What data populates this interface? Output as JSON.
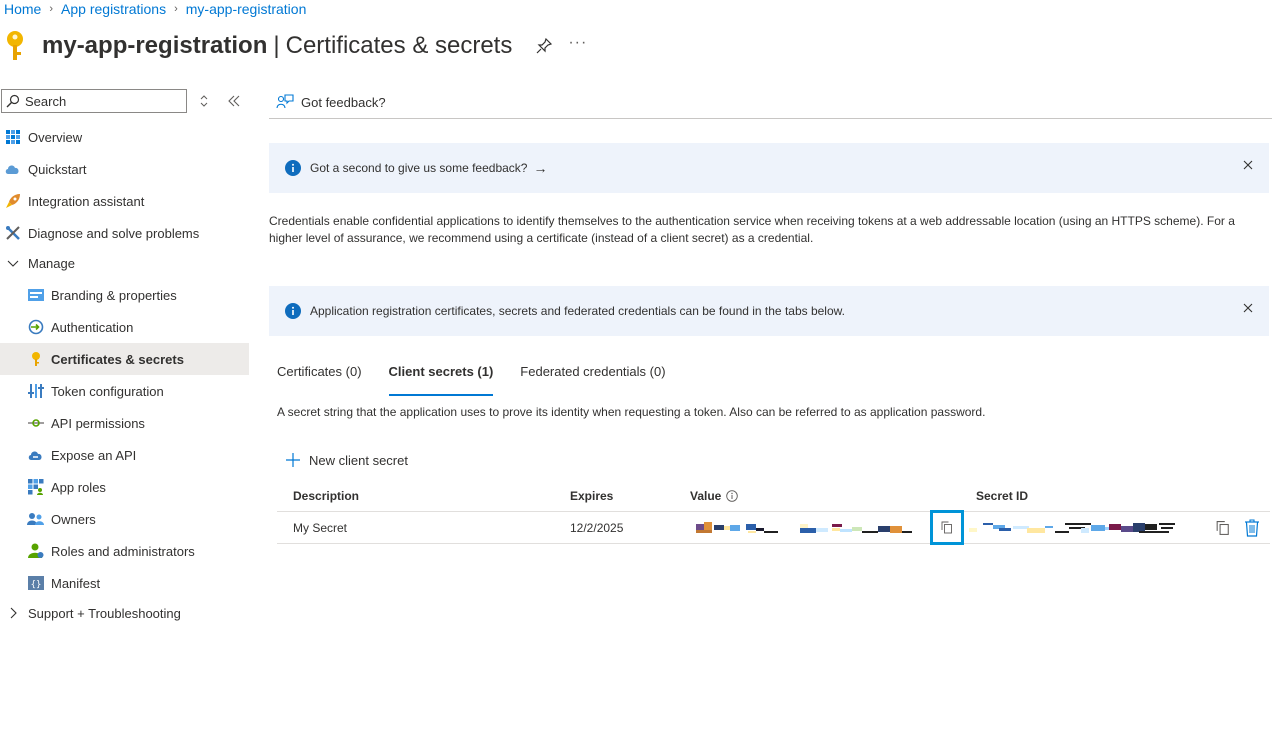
{
  "breadcrumb": {
    "home": "Home",
    "app_registrations": "App registrations",
    "current": "my-app-registration"
  },
  "title": {
    "app_name": "my-app-registration",
    "separator": "|",
    "page": "Certificates & secrets",
    "more": "···"
  },
  "sidebar": {
    "search_placeholder": "Search",
    "items": {
      "overview": "Overview",
      "quickstart": "Quickstart",
      "integration_assistant": "Integration assistant",
      "diagnose": "Diagnose and solve problems",
      "manage": "Manage",
      "branding": "Branding & properties",
      "authentication": "Authentication",
      "certificates": "Certificates & secrets",
      "token_configuration": "Token configuration",
      "api_permissions": "API permissions",
      "expose_api": "Expose an API",
      "app_roles": "App roles",
      "owners": "Owners",
      "roles_admins": "Roles and administrators",
      "manifest": "Manifest",
      "support": "Support + Troubleshooting"
    }
  },
  "toolbar": {
    "feedback": "Got feedback?"
  },
  "banners": {
    "feedback_prompt": "Got a second to give us some feedback?",
    "feedback_arrow": "→",
    "tabs_info": "Application registration certificates, secrets and federated credentials can be found in the tabs below."
  },
  "description": "Credentials enable confidential applications to identify themselves to the authentication service when receiving tokens at a web addressable location (using an HTTPS scheme). For a higher level of assurance, we recommend using a certificate (instead of a client secret) as a credential.",
  "tabs": {
    "certificates": "Certificates (0)",
    "client_secrets": "Client secrets (1)",
    "federated": "Federated credentials (0)"
  },
  "tab_description": "A secret string that the application uses to prove its identity when requesting a token. Also can be referred to as application password.",
  "new_secret_label": "New client secret",
  "table": {
    "headers": {
      "description": "Description",
      "expires": "Expires",
      "value": "Value",
      "secret_id": "Secret ID"
    },
    "rows": [
      {
        "description": "My Secret",
        "expires": "12/2/2025"
      }
    ]
  },
  "colors": {
    "accent": "#0078d4",
    "highlight": "#0094d8",
    "active_nav": "#edebe9",
    "banner": "#eef3fb"
  }
}
